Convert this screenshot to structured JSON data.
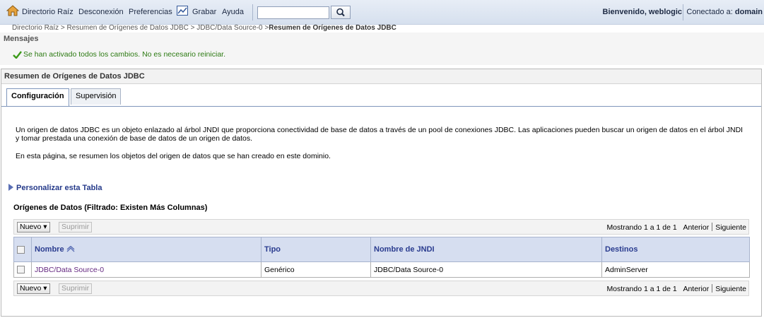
{
  "topbar": {
    "home_label": "Directorio Raíz",
    "logout_label": "Desconexión",
    "preferences_label": "Preferencias",
    "record_label": "Grabar",
    "help_label": "Ayuda",
    "search_value": "",
    "welcome_text": "Bienvenido, weblogic",
    "connected_label": "Conectado a:",
    "connected_domain": "domain"
  },
  "breadcrumb": {
    "items": [
      "Directorio Raíz >",
      "Resumen de Orígenes de Datos JDBC >",
      "JDBC/Data Source-0 >"
    ],
    "current": "Resumen de Orígenes de Datos JDBC"
  },
  "messages": {
    "title": "Mensajes",
    "success": "Se han activado todos los cambios. No es necesario reiniciar."
  },
  "panel": {
    "title": "Resumen de Orígenes de Datos JDBC",
    "tabs": [
      {
        "label": "Configuración",
        "active": true
      },
      {
        "label": "Supervisión",
        "active": false
      }
    ],
    "description1": "Un origen de datos JDBC es un objeto enlazado al árbol JNDI que proporciona conectividad de base de datos a través de un pool de conexiones JDBC. Las aplicaciones pueden buscar un origen de datos en el árbol JNDI y tomar prestada una conexión de base de datos de un origen de datos.",
    "description2": "En esta página, se resumen los objetos del origen de datos que se han creado en este dominio.",
    "customize_label": "Personalizar esta Tabla"
  },
  "table": {
    "title": "Orígenes de Datos (Filtrado: Existen Más Columnas)",
    "new_button": "Nuevo",
    "delete_button": "Suprimir",
    "paging_text": "Mostrando 1 a 1 de 1",
    "prev_label": "Anterior",
    "next_label": "Siguiente",
    "columns": [
      "Nombre",
      "Tipo",
      "Nombre de JNDI",
      "Destinos"
    ],
    "rows": [
      {
        "name": "JDBC/Data Source-0",
        "type": "Genérico",
        "jndi": "JDBC/Data Source-0",
        "targets": "AdminServer"
      }
    ]
  },
  "colors": {
    "success_green": "#2c7a12",
    "header_blue": "#d6def0",
    "link_purple": "#642880"
  }
}
